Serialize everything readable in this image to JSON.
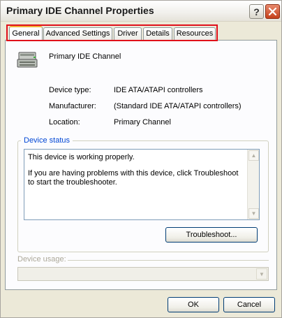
{
  "window": {
    "title": "Primary IDE Channel Properties",
    "help_glyph": "?"
  },
  "tabs": [
    {
      "label": "General",
      "active": true
    },
    {
      "label": "Advanced Settings",
      "active": false
    },
    {
      "label": "Driver",
      "active": false
    },
    {
      "label": "Details",
      "active": false
    },
    {
      "label": "Resources",
      "active": false
    }
  ],
  "device": {
    "icon": "ide-controller-icon",
    "name": "Primary IDE Channel",
    "fields": [
      {
        "label": "Device type:",
        "value": "IDE ATA/ATAPI controllers"
      },
      {
        "label": "Manufacturer:",
        "value": "(Standard IDE ATA/ATAPI controllers)"
      },
      {
        "label": "Location:",
        "value": "Primary Channel"
      }
    ]
  },
  "status": {
    "group_title": "Device status",
    "line1": "This device is working properly.",
    "line2": "If you are having problems with this device, click Troubleshoot to start the troubleshooter.",
    "troubleshoot_label": "Troubleshoot..."
  },
  "usage": {
    "label": "Device usage:",
    "selected": "",
    "enabled": false
  },
  "buttons": {
    "ok": "OK",
    "cancel": "Cancel"
  },
  "colors": {
    "highlight_box": "#e0101a",
    "group_title": "#0046d5",
    "active_tab_accent": "#f2b236"
  }
}
